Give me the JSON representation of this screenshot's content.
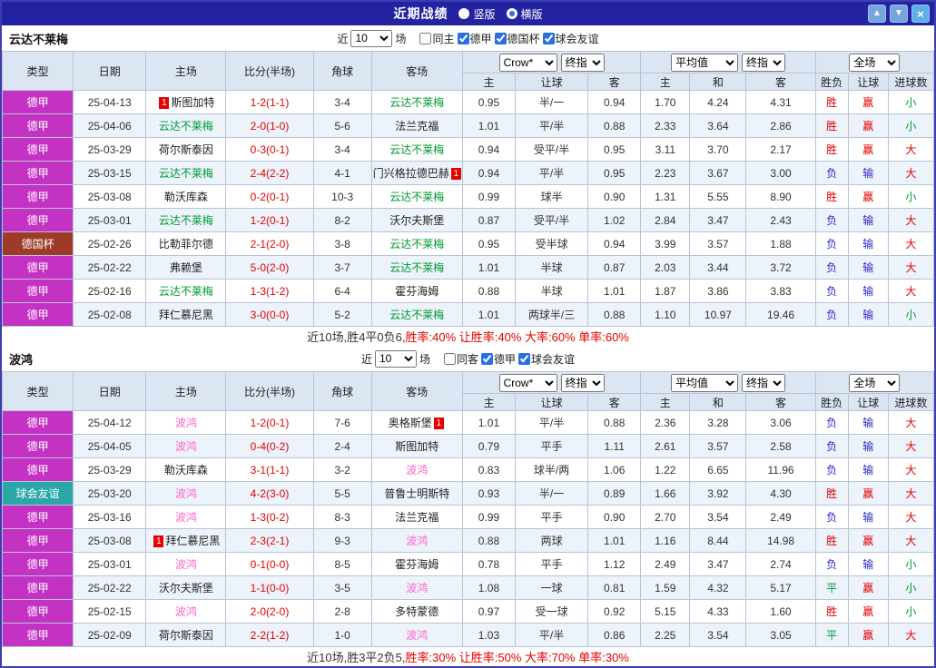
{
  "card_label": "1",
  "palette": {
    "red": "#e60000",
    "blue": "#2929cc",
    "green": "#009933",
    "pink": "#ff66cc",
    "black": "#222222",
    "type_colors": {
      "德甲": "#c432c4",
      "德国杯": "#9d3a28",
      "球会友谊": "#2ba7a7"
    }
  },
  "titlebar": {
    "title": "近期战绩",
    "radios": [
      {
        "label": "竖版",
        "checked": false
      },
      {
        "label": "横版",
        "checked": true
      }
    ],
    "buttons": {
      "up": "▲",
      "down": "▼",
      "close": "×"
    }
  },
  "header": {
    "dropdowns": {
      "crow": "Crow*",
      "final1": "终指",
      "avg": "平均值",
      "final2": "终指",
      "full": "全场"
    },
    "cols": [
      "类型",
      "日期",
      "主场",
      "比分(半场)",
      "角球",
      "客场"
    ],
    "subcols": [
      "主",
      "让球",
      "客",
      "主",
      "和",
      "客",
      "胜负",
      "让球",
      "进球数"
    ]
  },
  "sections": [
    {
      "team": "云达不莱梅",
      "filter": {
        "near_label": "近",
        "count": "10",
        "games_label": "场",
        "checkboxes": [
          {
            "label": "同主",
            "checked": false
          },
          {
            "label": "德甲",
            "checked": true
          },
          {
            "label": "德国杯",
            "checked": true
          },
          {
            "label": "球会友谊",
            "checked": true
          }
        ]
      },
      "rows": [
        {
          "type": "德甲",
          "date": "25-04-13",
          "home": "斯图加特",
          "home_color": "black",
          "home_card": "before",
          "score": "1-2(1-1)",
          "corner": "3-4",
          "away": "云达不莱梅",
          "away_color": "green",
          "away_card": null,
          "crown_home": "0.95",
          "handicap": "半/一",
          "crown_away": "0.94",
          "avg_home": "1.70",
          "avg_draw": "4.24",
          "avg_away": "4.31",
          "result": "胜",
          "result_color": "red",
          "handicap_result": "赢",
          "handicap_result_color": "red",
          "goals": "小",
          "goals_color": "green"
        },
        {
          "type": "德甲",
          "date": "25-04-06",
          "home": "云达不莱梅",
          "home_color": "green",
          "home_card": null,
          "score": "2-0(1-0)",
          "corner": "5-6",
          "away": "法兰克福",
          "away_color": "black",
          "away_card": null,
          "crown_home": "1.01",
          "handicap": "平/半",
          "crown_away": "0.88",
          "avg_home": "2.33",
          "avg_draw": "3.64",
          "avg_away": "2.86",
          "result": "胜",
          "result_color": "red",
          "handicap_result": "赢",
          "handicap_result_color": "red",
          "goals": "小",
          "goals_color": "green"
        },
        {
          "type": "德甲",
          "date": "25-03-29",
          "home": "荷尔斯泰因",
          "home_color": "black",
          "home_card": null,
          "score": "0-3(0-1)",
          "corner": "3-4",
          "away": "云达不莱梅",
          "away_color": "green",
          "away_card": null,
          "crown_home": "0.94",
          "handicap": "受平/半",
          "crown_away": "0.95",
          "avg_home": "3.11",
          "avg_draw": "3.70",
          "avg_away": "2.17",
          "result": "胜",
          "result_color": "red",
          "handicap_result": "赢",
          "handicap_result_color": "red",
          "goals": "大",
          "goals_color": "red"
        },
        {
          "type": "德甲",
          "date": "25-03-15",
          "home": "云达不莱梅",
          "home_color": "green",
          "home_card": null,
          "score": "2-4(2-2)",
          "corner": "4-1",
          "away": "门兴格拉德巴赫",
          "away_color": "black",
          "away_card": "after",
          "crown_home": "0.94",
          "handicap": "平/半",
          "crown_away": "0.95",
          "avg_home": "2.23",
          "avg_draw": "3.67",
          "avg_away": "3.00",
          "result": "负",
          "result_color": "blue",
          "handicap_result": "输",
          "handicap_result_color": "blue",
          "goals": "大",
          "goals_color": "red"
        },
        {
          "type": "德甲",
          "date": "25-03-08",
          "home": "勒沃库森",
          "home_color": "black",
          "home_card": null,
          "score": "0-2(0-1)",
          "corner": "10-3",
          "away": "云达不莱梅",
          "away_color": "green",
          "away_card": null,
          "crown_home": "0.99",
          "handicap": "球半",
          "crown_away": "0.90",
          "avg_home": "1.31",
          "avg_draw": "5.55",
          "avg_away": "8.90",
          "result": "胜",
          "result_color": "red",
          "handicap_result": "赢",
          "handicap_result_color": "red",
          "goals": "小",
          "goals_color": "green"
        },
        {
          "type": "德甲",
          "date": "25-03-01",
          "home": "云达不莱梅",
          "home_color": "green",
          "home_card": null,
          "score": "1-2(0-1)",
          "corner": "8-2",
          "away": "沃尔夫斯堡",
          "away_color": "black",
          "away_card": null,
          "crown_home": "0.87",
          "handicap": "受平/半",
          "crown_away": "1.02",
          "avg_home": "2.84",
          "avg_draw": "3.47",
          "avg_away": "2.43",
          "result": "负",
          "result_color": "blue",
          "handicap_result": "输",
          "handicap_result_color": "blue",
          "goals": "大",
          "goals_color": "red"
        },
        {
          "type": "德国杯",
          "date": "25-02-26",
          "home": "比勒菲尔德",
          "home_color": "black",
          "home_card": null,
          "score": "2-1(2-0)",
          "corner": "3-8",
          "away": "云达不莱梅",
          "away_color": "green",
          "away_card": null,
          "crown_home": "0.95",
          "handicap": "受半球",
          "crown_away": "0.94",
          "avg_home": "3.99",
          "avg_draw": "3.57",
          "avg_away": "1.88",
          "result": "负",
          "result_color": "blue",
          "handicap_result": "输",
          "handicap_result_color": "blue",
          "goals": "大",
          "goals_color": "red"
        },
        {
          "type": "德甲",
          "date": "25-02-22",
          "home": "弗赖堡",
          "home_color": "black",
          "home_card": null,
          "score": "5-0(2-0)",
          "corner": "3-7",
          "away": "云达不莱梅",
          "away_color": "green",
          "away_card": null,
          "crown_home": "1.01",
          "handicap": "半球",
          "crown_away": "0.87",
          "avg_home": "2.03",
          "avg_draw": "3.44",
          "avg_away": "3.72",
          "result": "负",
          "result_color": "blue",
          "handicap_result": "输",
          "handicap_result_color": "blue",
          "goals": "大",
          "goals_color": "red"
        },
        {
          "type": "德甲",
          "date": "25-02-16",
          "home": "云达不莱梅",
          "home_color": "green",
          "home_card": null,
          "score": "1-3(1-2)",
          "corner": "6-4",
          "away": "霍芬海姆",
          "away_color": "black",
          "away_card": null,
          "crown_home": "0.88",
          "handicap": "半球",
          "crown_away": "1.01",
          "avg_home": "1.87",
          "avg_draw": "3.86",
          "avg_away": "3.83",
          "result": "负",
          "result_color": "blue",
          "handicap_result": "输",
          "handicap_result_color": "blue",
          "goals": "大",
          "goals_color": "red"
        },
        {
          "type": "德甲",
          "date": "25-02-08",
          "home": "拜仁慕尼黑",
          "home_color": "black",
          "home_card": null,
          "score": "3-0(0-0)",
          "corner": "5-2",
          "away": "云达不莱梅",
          "away_color": "green",
          "away_card": null,
          "crown_home": "1.01",
          "handicap": "两球半/三",
          "crown_away": "0.88",
          "avg_home": "1.10",
          "avg_draw": "10.97",
          "avg_away": "19.46",
          "result": "负",
          "result_color": "blue",
          "handicap_result": "输",
          "handicap_result_color": "blue",
          "goals": "小",
          "goals_color": "green"
        }
      ],
      "summary_prefix": "近10场,胜4平0负6, ",
      "summary_rates": "胜率:40% 让胜率:40% 大率:60% 单率:60%"
    },
    {
      "team": "波鸿",
      "filter": {
        "near_label": "近",
        "count": "10",
        "games_label": "场",
        "checkboxes": [
          {
            "label": "同客",
            "checked": false
          },
          {
            "label": "德甲",
            "checked": true
          },
          {
            "label": "球会友谊",
            "checked": true
          }
        ]
      },
      "rows": [
        {
          "type": "德甲",
          "date": "25-04-12",
          "home": "波鸿",
          "home_color": "pink",
          "home_card": null,
          "score": "1-2(0-1)",
          "corner": "7-6",
          "away": "奥格斯堡",
          "away_color": "black",
          "away_card": "after",
          "crown_home": "1.01",
          "handicap": "平/半",
          "crown_away": "0.88",
          "avg_home": "2.36",
          "avg_draw": "3.28",
          "avg_away": "3.06",
          "result": "负",
          "result_color": "blue",
          "handicap_result": "输",
          "handicap_result_color": "blue",
          "goals": "大",
          "goals_color": "red"
        },
        {
          "type": "德甲",
          "date": "25-04-05",
          "home": "波鸿",
          "home_color": "pink",
          "home_card": null,
          "score": "0-4(0-2)",
          "corner": "2-4",
          "away": "斯图加特",
          "away_color": "black",
          "away_card": null,
          "crown_home": "0.79",
          "handicap": "平手",
          "crown_away": "1.11",
          "avg_home": "2.61",
          "avg_draw": "3.57",
          "avg_away": "2.58",
          "result": "负",
          "result_color": "blue",
          "handicap_result": "输",
          "handicap_result_color": "blue",
          "goals": "大",
          "goals_color": "red"
        },
        {
          "type": "德甲",
          "date": "25-03-29",
          "home": "勒沃库森",
          "home_color": "black",
          "home_card": null,
          "score": "3-1(1-1)",
          "corner": "3-2",
          "away": "波鸿",
          "away_color": "pink",
          "away_card": null,
          "crown_home": "0.83",
          "handicap": "球半/两",
          "crown_away": "1.06",
          "avg_home": "1.22",
          "avg_draw": "6.65",
          "avg_away": "11.96",
          "result": "负",
          "result_color": "blue",
          "handicap_result": "输",
          "handicap_result_color": "blue",
          "goals": "大",
          "goals_color": "red"
        },
        {
          "type": "球会友谊",
          "date": "25-03-20",
          "home": "波鸿",
          "home_color": "pink",
          "home_card": null,
          "score": "4-2(3-0)",
          "corner": "5-5",
          "away": "普鲁士明斯特",
          "away_color": "black",
          "away_card": null,
          "crown_home": "0.93",
          "handicap": "半/一",
          "crown_away": "0.89",
          "avg_home": "1.66",
          "avg_draw": "3.92",
          "avg_away": "4.30",
          "result": "胜",
          "result_color": "red",
          "handicap_result": "赢",
          "handicap_result_color": "red",
          "goals": "大",
          "goals_color": "red"
        },
        {
          "type": "德甲",
          "date": "25-03-16",
          "home": "波鸿",
          "home_color": "pink",
          "home_card": null,
          "score": "1-3(0-2)",
          "corner": "8-3",
          "away": "法兰克福",
          "away_color": "black",
          "away_card": null,
          "crown_home": "0.99",
          "handicap": "平手",
          "crown_away": "0.90",
          "avg_home": "2.70",
          "avg_draw": "3.54",
          "avg_away": "2.49",
          "result": "负",
          "result_color": "blue",
          "handicap_result": "输",
          "handicap_result_color": "blue",
          "goals": "大",
          "goals_color": "red"
        },
        {
          "type": "德甲",
          "date": "25-03-08",
          "home": "拜仁慕尼黑",
          "home_color": "black",
          "home_card": "before",
          "score": "2-3(2-1)",
          "corner": "9-3",
          "away": "波鸿",
          "away_color": "pink",
          "away_card": null,
          "crown_home": "0.88",
          "handicap": "两球",
          "crown_away": "1.01",
          "avg_home": "1.16",
          "avg_draw": "8.44",
          "avg_away": "14.98",
          "result": "胜",
          "result_color": "red",
          "handicap_result": "赢",
          "handicap_result_color": "red",
          "goals": "大",
          "goals_color": "red"
        },
        {
          "type": "德甲",
          "date": "25-03-01",
          "home": "波鸿",
          "home_color": "pink",
          "home_card": null,
          "score": "0-1(0-0)",
          "corner": "8-5",
          "away": "霍芬海姆",
          "away_color": "black",
          "away_card": null,
          "crown_home": "0.78",
          "handicap": "平手",
          "crown_away": "1.12",
          "avg_home": "2.49",
          "avg_draw": "3.47",
          "avg_away": "2.74",
          "result": "负",
          "result_color": "blue",
          "handicap_result": "输",
          "handicap_result_color": "blue",
          "goals": "小",
          "goals_color": "green"
        },
        {
          "type": "德甲",
          "date": "25-02-22",
          "home": "沃尔夫斯堡",
          "home_color": "black",
          "home_card": null,
          "score": "1-1(0-0)",
          "corner": "3-5",
          "away": "波鸿",
          "away_color": "pink",
          "away_card": null,
          "crown_home": "1.08",
          "handicap": "一球",
          "crown_away": "0.81",
          "avg_home": "1.59",
          "avg_draw": "4.32",
          "avg_away": "5.17",
          "result": "平",
          "result_color": "green",
          "handicap_result": "赢",
          "handicap_result_color": "red",
          "goals": "小",
          "goals_color": "green"
        },
        {
          "type": "德甲",
          "date": "25-02-15",
          "home": "波鸿",
          "home_color": "pink",
          "home_card": null,
          "score": "2-0(2-0)",
          "corner": "2-8",
          "away": "多特蒙德",
          "away_color": "black",
          "away_card": null,
          "crown_home": "0.97",
          "handicap": "受一球",
          "crown_away": "0.92",
          "avg_home": "5.15",
          "avg_draw": "4.33",
          "avg_away": "1.60",
          "result": "胜",
          "result_color": "red",
          "handicap_result": "赢",
          "handicap_result_color": "red",
          "goals": "小",
          "goals_color": "green"
        },
        {
          "type": "德甲",
          "date": "25-02-09",
          "home": "荷尔斯泰因",
          "home_color": "black",
          "home_card": null,
          "score": "2-2(1-2)",
          "corner": "1-0",
          "away": "波鸿",
          "away_color": "pink",
          "away_card": null,
          "crown_home": "1.03",
          "handicap": "平/半",
          "crown_away": "0.86",
          "avg_home": "2.25",
          "avg_draw": "3.54",
          "avg_away": "3.05",
          "result": "平",
          "result_color": "green",
          "handicap_result": "赢",
          "handicap_result_color": "red",
          "goals": "大",
          "goals_color": "red"
        }
      ],
      "summary_prefix": "近10场,胜3平2负5, ",
      "summary_rates": "胜率:30% 让胜率:50% 大率:70% 单率:30%"
    }
  ]
}
